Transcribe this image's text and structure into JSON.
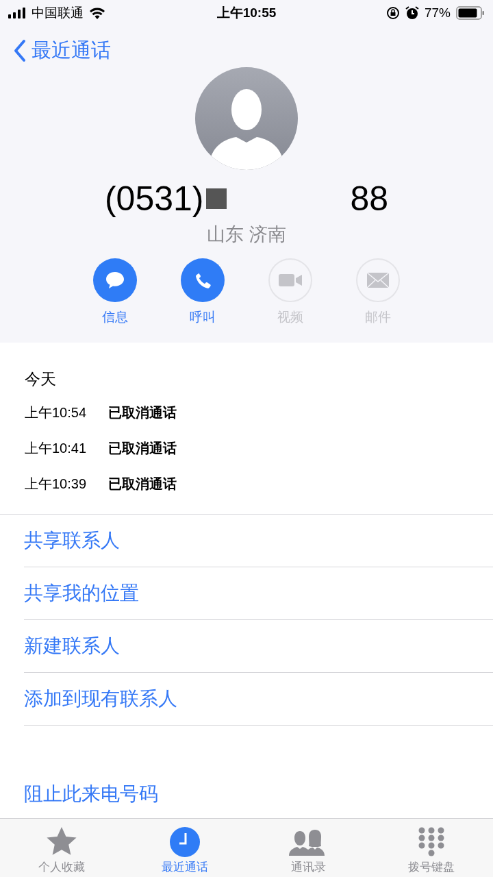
{
  "status_bar": {
    "carrier": "中国联通",
    "time": "上午10:55",
    "battery": "77%"
  },
  "nav": {
    "back": "最近通话"
  },
  "contact": {
    "number_prefix": "(0531)",
    "number_suffix": "88",
    "location": "山东 济南"
  },
  "actions": [
    {
      "kind": "message",
      "label": "信息",
      "disabled": false
    },
    {
      "kind": "call",
      "label": "呼叫",
      "disabled": false
    },
    {
      "kind": "video",
      "label": "视频",
      "disabled": true
    },
    {
      "kind": "mail",
      "label": "邮件",
      "disabled": true
    }
  ],
  "history": {
    "heading": "今天",
    "calls": [
      {
        "time": "上午10:54",
        "status": "已取消通话"
      },
      {
        "time": "上午10:41",
        "status": "已取消通话"
      },
      {
        "time": "上午10:39",
        "status": "已取消通话"
      }
    ]
  },
  "options": [
    "共享联系人",
    "共享我的位置",
    "新建联系人",
    "添加到现有联系人"
  ],
  "block": "阻止此来电号码",
  "tabs": [
    {
      "kind": "favorites",
      "label": "个人收藏",
      "selected": false
    },
    {
      "kind": "recents",
      "label": "最近通话",
      "selected": true
    },
    {
      "kind": "contacts",
      "label": "通讯录",
      "selected": false
    },
    {
      "kind": "keypad",
      "label": "拨号键盘",
      "selected": false
    }
  ]
}
